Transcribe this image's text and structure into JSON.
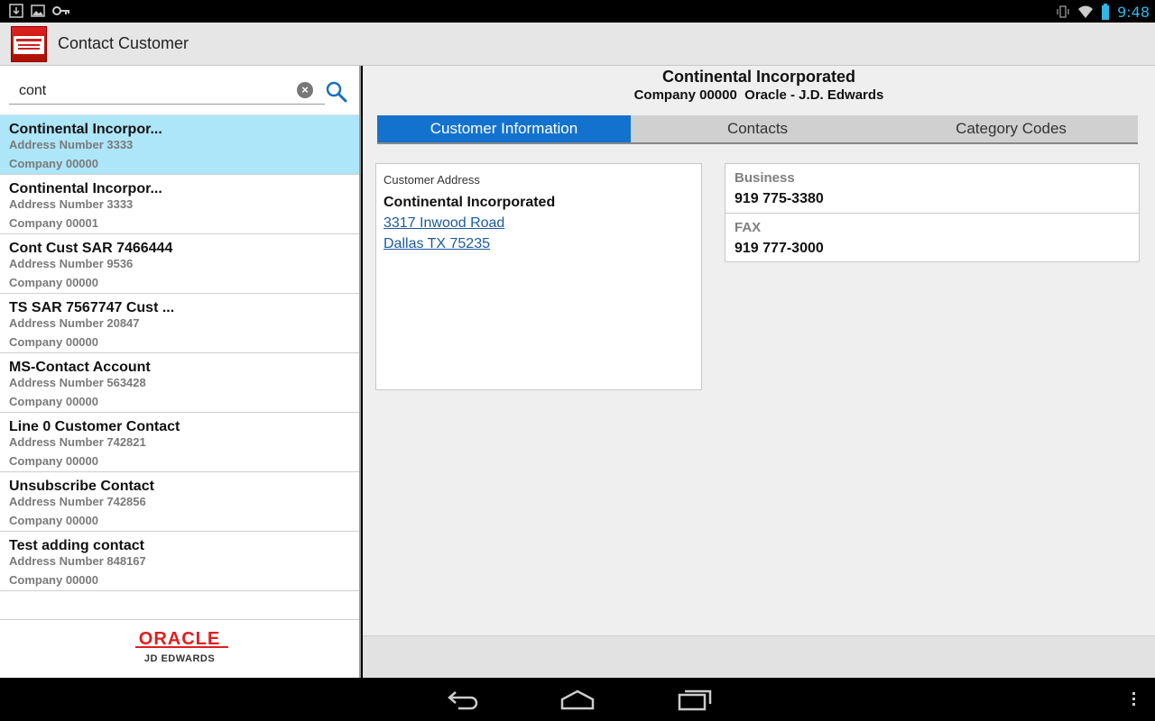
{
  "status_bar": {
    "time": "9:48",
    "icons": [
      "download-icon",
      "image-icon",
      "key-icon",
      "vibrate-icon",
      "wifi-icon",
      "battery-icon"
    ]
  },
  "action_bar": {
    "title": "Contact Customer",
    "logo_icon": "oracle-jde-app-icon"
  },
  "search": {
    "value": "cont",
    "clear_icon": "clear-icon",
    "search_icon": "search-icon"
  },
  "results": [
    {
      "name": "Continental Incorpor...",
      "address": "Address Number 3333",
      "company": "Company 00000",
      "selected": true
    },
    {
      "name": "Continental Incorpor...",
      "address": "Address Number 3333",
      "company": "Company 00001",
      "selected": false
    },
    {
      "name": "Cont Cust SAR 7466444",
      "address": "Address Number 9536",
      "company": "Company 00000",
      "selected": false
    },
    {
      "name": "TS SAR 7567747 Cust ...",
      "address": "Address Number 20847",
      "company": "Company 00000",
      "selected": false
    },
    {
      "name": "MS-Contact Account",
      "address": "Address Number 563428",
      "company": "Company 00000",
      "selected": false
    },
    {
      "name": "Line 0 Customer Contact",
      "address": "Address Number 742821",
      "company": "Company 00000",
      "selected": false
    },
    {
      "name": "Unsubscribe Contact",
      "address": "Address Number 742856",
      "company": "Company 00000",
      "selected": false
    },
    {
      "name": "Test adding contact",
      "address": "Address Number 848167",
      "company": "Company 00000",
      "selected": false
    }
  ],
  "brand": {
    "oracle": "ORACLE",
    "jde": "JD EDWARDS"
  },
  "detail": {
    "title": "Continental Incorporated",
    "subtitle": "Company 00000  Oracle - J.D. Edwards",
    "tabs": [
      {
        "label": "Customer Information",
        "active": true
      },
      {
        "label": "Contacts",
        "active": false
      },
      {
        "label": "Category Codes",
        "active": false
      }
    ],
    "address_card": {
      "label": "Customer Address",
      "name": "Continental Incorporated",
      "line1": "3317 Inwood Road",
      "line2": "Dallas TX 75235"
    },
    "phones": [
      {
        "label": "Business",
        "value": "919 775-3380"
      },
      {
        "label": "FAX",
        "value": "919 777-3000"
      }
    ]
  },
  "nav_bar": {
    "icons": [
      "back-icon",
      "home-icon",
      "recent-apps-icon",
      "overflow-menu-icon"
    ]
  },
  "colors": {
    "accent": "#1472cf",
    "selected_row": "#ade5f9",
    "status_clock": "#33b5e5",
    "brand_red": "#e01e1e"
  }
}
